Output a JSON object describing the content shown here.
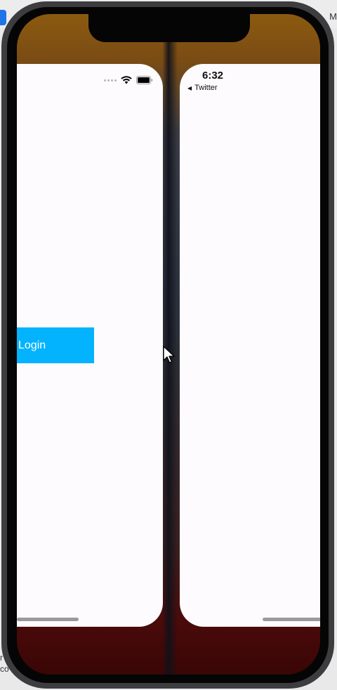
{
  "host": {
    "right_letter": "M",
    "left_text": "r\nco"
  },
  "left_app": {
    "login_label": "Login"
  },
  "right_app": {
    "time": "6:32",
    "back_label": "Twitter"
  },
  "icons": {
    "wifi": "wifi-icon",
    "battery": "battery-icon",
    "back": "back-arrow-icon",
    "cursor": "mouse-pointer-icon"
  },
  "colors": {
    "login_button": "#03b3fd",
    "card_background": "#fdfbfe"
  }
}
